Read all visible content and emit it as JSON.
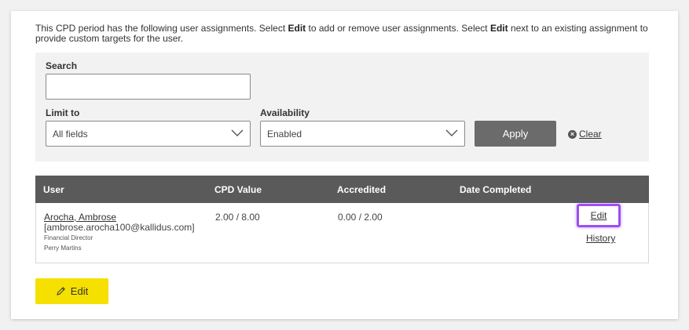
{
  "intro": {
    "part1": "This CPD period has the following user assignments. Select ",
    "bold1": "Edit",
    "part2": " to add or remove user assignments. Select ",
    "bold2": "Edit",
    "part3": " next to an existing assignment to provide custom targets for the user."
  },
  "filter": {
    "search_label": "Search",
    "search_value": "",
    "limit_label": "Limit to",
    "limit_value": "All fields",
    "availability_label": "Availability",
    "availability_value": "Enabled",
    "apply_label": "Apply",
    "clear_label": "Clear"
  },
  "table": {
    "headers": [
      "User",
      "CPD Value",
      "Accredited",
      "Date Completed"
    ],
    "rows": [
      {
        "user_name": "Arocha, Ambrose",
        "user_email": "[ambrose.arocha100@kallidus.com]",
        "job_title": "Financial Director",
        "manager": "Perry Martins",
        "cpd_value": "2.00 / 8.00",
        "accredited": "0.00 / 2.00",
        "date_completed": "",
        "edit_label": "Edit",
        "history_label": "History"
      }
    ]
  },
  "footer": {
    "edit_label": "Edit"
  },
  "colors": {
    "header_bg": "#5a5a5a",
    "apply_bg": "#6b6b6b",
    "edit_button_bg": "#f5e000",
    "highlight": "#9d4ff0"
  },
  "icons": {
    "clear": "x-circle-icon",
    "edit": "pencil-icon",
    "dropdown": "chevron-down-icon"
  }
}
